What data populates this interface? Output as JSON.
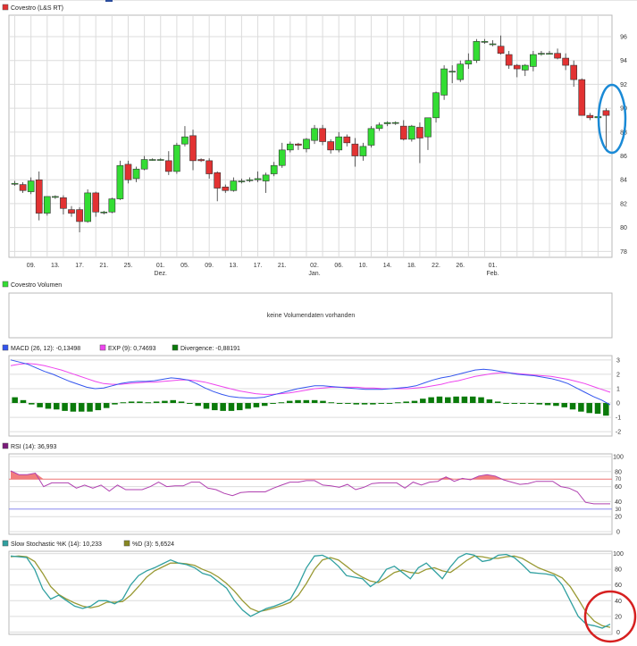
{
  "colors": {
    "candle_up": "#33dd33",
    "candle_down": "#e23232",
    "macd": "#3355ee",
    "exp": "#ee44ee",
    "divergence": "#0a7a0a",
    "rsi": "#b040b0",
    "rsi_upper": "#ee7777",
    "rsi_lower": "#8888ee",
    "stoch_k": "#30a0a0",
    "stoch_d": "#999933",
    "annotation_blue": "#1a8ad6",
    "annotation_red": "#d62020"
  },
  "chart_data": [
    {
      "type": "candlestick",
      "legend": "Covestro (L&S RT)",
      "yticks": [
        96,
        94,
        92,
        90,
        88,
        86,
        84,
        82,
        80,
        78
      ],
      "ylim": [
        77.5,
        97.8
      ],
      "xticks": [
        {
          "i": 2,
          "label": "09."
        },
        {
          "i": 5,
          "label": "13."
        },
        {
          "i": 8,
          "label": "17."
        },
        {
          "i": 11,
          "label": "21."
        },
        {
          "i": 14,
          "label": "25."
        },
        {
          "i": 18,
          "label": "01.",
          "sub": "Dez."
        },
        {
          "i": 21,
          "label": "05."
        },
        {
          "i": 24,
          "label": "09."
        },
        {
          "i": 27,
          "label": "13."
        },
        {
          "i": 30,
          "label": "17."
        },
        {
          "i": 33,
          "label": "21."
        },
        {
          "i": 37,
          "label": "02.",
          "sub": "Jan."
        },
        {
          "i": 40,
          "label": "06."
        },
        {
          "i": 43,
          "label": "10."
        },
        {
          "i": 46,
          "label": "14."
        },
        {
          "i": 49,
          "label": "18."
        },
        {
          "i": 52,
          "label": "22."
        },
        {
          "i": 55,
          "label": "26."
        },
        {
          "i": 59,
          "label": "01.",
          "sub": "Feb."
        }
      ],
      "candles": [
        {
          "o": 83.7,
          "h": 83.9,
          "l": 83.5,
          "c": 83.7
        },
        {
          "o": 83.6,
          "h": 83.8,
          "l": 82.9,
          "c": 83.1
        },
        {
          "o": 83.0,
          "h": 84.2,
          "l": 82.8,
          "c": 83.9
        },
        {
          "o": 84.0,
          "h": 84.7,
          "l": 80.6,
          "c": 81.2
        },
        {
          "o": 81.2,
          "h": 82.6,
          "l": 81.0,
          "c": 82.6
        },
        {
          "o": 82.6,
          "h": 82.7,
          "l": 82.4,
          "c": 82.6
        },
        {
          "o": 82.5,
          "h": 82.7,
          "l": 81.1,
          "c": 81.6
        },
        {
          "o": 81.5,
          "h": 81.8,
          "l": 80.9,
          "c": 81.2
        },
        {
          "o": 81.5,
          "h": 81.7,
          "l": 79.6,
          "c": 80.5
        },
        {
          "o": 80.5,
          "h": 83.2,
          "l": 80.4,
          "c": 82.9
        },
        {
          "o": 82.9,
          "h": 83.0,
          "l": 80.9,
          "c": 81.3
        },
        {
          "o": 81.3,
          "h": 81.4,
          "l": 81.1,
          "c": 81.3
        },
        {
          "o": 81.3,
          "h": 82.5,
          "l": 81.2,
          "c": 82.4
        },
        {
          "o": 82.4,
          "h": 85.6,
          "l": 82.3,
          "c": 85.2
        },
        {
          "o": 85.3,
          "h": 85.6,
          "l": 83.7,
          "c": 84.0
        },
        {
          "o": 84.1,
          "h": 85.1,
          "l": 83.8,
          "c": 84.9
        },
        {
          "o": 84.9,
          "h": 86.0,
          "l": 84.8,
          "c": 85.7
        },
        {
          "o": 85.7,
          "h": 85.8,
          "l": 85.6,
          "c": 85.7
        },
        {
          "o": 85.7,
          "h": 85.8,
          "l": 85.6,
          "c": 85.7
        },
        {
          "o": 85.6,
          "h": 86.4,
          "l": 84.4,
          "c": 84.7
        },
        {
          "o": 84.7,
          "h": 87.1,
          "l": 84.5,
          "c": 86.9
        },
        {
          "o": 87.0,
          "h": 88.5,
          "l": 86.8,
          "c": 87.6
        },
        {
          "o": 87.7,
          "h": 88.2,
          "l": 84.8,
          "c": 85.6
        },
        {
          "o": 85.7,
          "h": 85.8,
          "l": 85.5,
          "c": 85.6
        },
        {
          "o": 85.6,
          "h": 85.8,
          "l": 84.1,
          "c": 84.5
        },
        {
          "o": 84.6,
          "h": 84.7,
          "l": 82.2,
          "c": 83.3
        },
        {
          "o": 83.4,
          "h": 83.6,
          "l": 82.9,
          "c": 83.1
        },
        {
          "o": 83.1,
          "h": 84.2,
          "l": 83.0,
          "c": 83.9
        },
        {
          "o": 83.9,
          "h": 84.1,
          "l": 83.7,
          "c": 83.9
        },
        {
          "o": 84.0,
          "h": 84.2,
          "l": 83.8,
          "c": 84.0
        },
        {
          "o": 84.0,
          "h": 84.7,
          "l": 83.8,
          "c": 84.1
        },
        {
          "o": 83.9,
          "h": 84.6,
          "l": 82.9,
          "c": 84.4
        },
        {
          "o": 84.5,
          "h": 85.5,
          "l": 84.3,
          "c": 85.2
        },
        {
          "o": 85.2,
          "h": 87.1,
          "l": 85.0,
          "c": 86.5
        },
        {
          "o": 86.5,
          "h": 87.2,
          "l": 86.3,
          "c": 87.0
        },
        {
          "o": 87.0,
          "h": 87.1,
          "l": 86.5,
          "c": 86.9
        },
        {
          "o": 86.6,
          "h": 87.5,
          "l": 86.3,
          "c": 87.4
        },
        {
          "o": 87.3,
          "h": 88.6,
          "l": 87.0,
          "c": 88.3
        },
        {
          "o": 88.3,
          "h": 88.6,
          "l": 86.9,
          "c": 87.2
        },
        {
          "o": 87.2,
          "h": 87.4,
          "l": 86.2,
          "c": 86.5
        },
        {
          "o": 86.5,
          "h": 88.0,
          "l": 86.3,
          "c": 87.6
        },
        {
          "o": 87.6,
          "h": 87.8,
          "l": 86.8,
          "c": 87.1
        },
        {
          "o": 87.0,
          "h": 87.5,
          "l": 85.1,
          "c": 86.0
        },
        {
          "o": 86.0,
          "h": 87.1,
          "l": 85.6,
          "c": 86.8
        },
        {
          "o": 86.9,
          "h": 88.5,
          "l": 86.7,
          "c": 88.3
        },
        {
          "o": 88.3,
          "h": 88.8,
          "l": 88.1,
          "c": 88.6
        },
        {
          "o": 88.7,
          "h": 88.9,
          "l": 88.5,
          "c": 88.8
        },
        {
          "o": 88.8,
          "h": 88.9,
          "l": 88.6,
          "c": 88.8
        },
        {
          "o": 88.5,
          "h": 89.0,
          "l": 87.3,
          "c": 87.4
        },
        {
          "o": 87.4,
          "h": 88.6,
          "l": 87.2,
          "c": 88.5
        },
        {
          "o": 88.4,
          "h": 88.8,
          "l": 85.4,
          "c": 87.5
        },
        {
          "o": 87.6,
          "h": 89.2,
          "l": 86.5,
          "c": 89.2
        },
        {
          "o": 89.2,
          "h": 91.4,
          "l": 88.8,
          "c": 91.3
        },
        {
          "o": 91.1,
          "h": 93.6,
          "l": 90.7,
          "c": 93.3
        },
        {
          "o": 93.1,
          "h": 93.6,
          "l": 92.1,
          "c": 93.1
        },
        {
          "o": 92.4,
          "h": 94.0,
          "l": 92.2,
          "c": 93.7
        },
        {
          "o": 93.7,
          "h": 94.6,
          "l": 93.3,
          "c": 94.0
        },
        {
          "o": 94.0,
          "h": 95.8,
          "l": 93.8,
          "c": 95.6
        },
        {
          "o": 95.6,
          "h": 95.8,
          "l": 95.4,
          "c": 95.6
        },
        {
          "o": 95.4,
          "h": 95.7,
          "l": 95.2,
          "c": 95.4
        },
        {
          "o": 95.2,
          "h": 96.1,
          "l": 94.5,
          "c": 94.6
        },
        {
          "o": 94.5,
          "h": 94.8,
          "l": 93.3,
          "c": 93.6
        },
        {
          "o": 93.6,
          "h": 93.7,
          "l": 92.6,
          "c": 93.3
        },
        {
          "o": 93.2,
          "h": 93.7,
          "l": 92.7,
          "c": 93.6
        },
        {
          "o": 93.5,
          "h": 94.8,
          "l": 93.1,
          "c": 94.5
        },
        {
          "o": 94.6,
          "h": 94.8,
          "l": 94.4,
          "c": 94.6
        },
        {
          "o": 94.6,
          "h": 94.8,
          "l": 94.5,
          "c": 94.6
        },
        {
          "o": 94.6,
          "h": 95.0,
          "l": 94.1,
          "c": 94.2
        },
        {
          "o": 94.2,
          "h": 94.6,
          "l": 93.2,
          "c": 93.6
        },
        {
          "o": 93.6,
          "h": 94.0,
          "l": 91.8,
          "c": 92.4
        },
        {
          "o": 92.4,
          "h": 92.5,
          "l": 89.4,
          "c": 89.4
        },
        {
          "o": 89.4,
          "h": 89.6,
          "l": 89.0,
          "c": 89.2
        },
        {
          "o": 89.2,
          "h": 89.5,
          "l": 88.6,
          "c": 89.3
        },
        {
          "o": 89.8,
          "h": 90.0,
          "l": 86.4,
          "c": 89.4
        }
      ]
    },
    {
      "type": "table",
      "legend": "Covestro Volumen",
      "message": "keine Volumendaten vorhanden"
    },
    {
      "type": "line",
      "legend": [
        {
          "text": "MACD (26, 12): -0,13498",
          "color": "#3355ee"
        },
        {
          "text": "EXP (9): 0,74693",
          "color": "#ee44ee"
        },
        {
          "text": "Divergence: -0,88191",
          "color": "#0a7a0a"
        }
      ],
      "yticks": [
        3,
        2,
        1,
        0,
        -1,
        -2
      ],
      "ylim": [
        -2.3,
        3.3
      ],
      "macd": [
        3.0,
        2.85,
        2.7,
        2.45,
        2.2,
        2.0,
        1.75,
        1.5,
        1.3,
        1.1,
        1.0,
        1.05,
        1.2,
        1.35,
        1.45,
        1.5,
        1.5,
        1.55,
        1.65,
        1.75,
        1.7,
        1.6,
        1.35,
        1.05,
        0.8,
        0.6,
        0.45,
        0.38,
        0.35,
        0.35,
        0.4,
        0.55,
        0.7,
        0.85,
        1.0,
        1.1,
        1.2,
        1.2,
        1.15,
        1.1,
        1.05,
        1.0,
        0.95,
        0.95,
        0.95,
        1.0,
        1.05,
        1.1,
        1.2,
        1.4,
        1.6,
        1.75,
        1.85,
        2.0,
        2.15,
        2.3,
        2.35,
        2.3,
        2.2,
        2.1,
        2.0,
        1.95,
        1.9,
        1.8,
        1.7,
        1.55,
        1.35,
        1.05,
        0.75,
        0.45,
        0.2,
        -0.13
      ],
      "exp": [
        2.6,
        2.7,
        2.75,
        2.7,
        2.6,
        2.45,
        2.3,
        2.1,
        1.9,
        1.7,
        1.5,
        1.35,
        1.3,
        1.3,
        1.35,
        1.4,
        1.45,
        1.45,
        1.5,
        1.55,
        1.6,
        1.6,
        1.55,
        1.45,
        1.3,
        1.15,
        1.0,
        0.85,
        0.75,
        0.65,
        0.6,
        0.6,
        0.65,
        0.7,
        0.8,
        0.9,
        1.0,
        1.05,
        1.1,
        1.1,
        1.1,
        1.1,
        1.05,
        1.05,
        1.0,
        1.0,
        1.0,
        1.0,
        1.05,
        1.1,
        1.2,
        1.3,
        1.45,
        1.55,
        1.7,
        1.85,
        1.95,
        2.05,
        2.1,
        2.1,
        2.05,
        2.0,
        1.95,
        1.9,
        1.85,
        1.75,
        1.65,
        1.5,
        1.35,
        1.15,
        0.95,
        0.75
      ],
      "divergence": [
        0.4,
        0.2,
        -0.1,
        -0.3,
        -0.4,
        -0.45,
        -0.55,
        -0.6,
        -0.6,
        -0.6,
        -0.5,
        -0.35,
        -0.1,
        0.05,
        0.1,
        0.1,
        0.05,
        0.1,
        0.15,
        0.2,
        0.1,
        0.0,
        -0.2,
        -0.4,
        -0.5,
        -0.55,
        -0.55,
        -0.5,
        -0.4,
        -0.3,
        -0.2,
        -0.05,
        0.05,
        0.15,
        0.2,
        0.2,
        0.2,
        0.15,
        0.05,
        0.0,
        -0.05,
        -0.1,
        -0.1,
        -0.1,
        -0.05,
        0.0,
        0.05,
        0.1,
        0.15,
        0.3,
        0.4,
        0.45,
        0.4,
        0.45,
        0.45,
        0.45,
        0.4,
        0.25,
        0.1,
        0.0,
        -0.05,
        -0.05,
        -0.05,
        -0.1,
        -0.15,
        -0.2,
        -0.3,
        -0.45,
        -0.6,
        -0.7,
        -0.75,
        -0.88
      ]
    },
    {
      "type": "line",
      "legend": [
        {
          "text": "RSI (14): 36,993",
          "color": "#b040b0"
        }
      ],
      "yticks": [
        100,
        80,
        60,
        40,
        20,
        0
      ],
      "ylim": [
        0,
        100
      ],
      "upper": 70,
      "lower": 30,
      "rsi": [
        81,
        76,
        76,
        78,
        60,
        65,
        65,
        65,
        58,
        62,
        58,
        62,
        54,
        62,
        56,
        56,
        56,
        60,
        66,
        60,
        61,
        61,
        66,
        66,
        58,
        56,
        51,
        48,
        52,
        53,
        53,
        53,
        58,
        62,
        66,
        66,
        68,
        68,
        62,
        61,
        59,
        63,
        56,
        59,
        64,
        65,
        65,
        65,
        58,
        66,
        62,
        66,
        67,
        73,
        67,
        71,
        69,
        74,
        76,
        74,
        69,
        66,
        63,
        64,
        67,
        67,
        67,
        60,
        58,
        53,
        39,
        37,
        37,
        37
      ],
      "rsi_label_upper": "70",
      "rsi_label_lower": "30"
    },
    {
      "type": "line",
      "legend": [
        {
          "text": "Slow Stochastic %K (14): 10,233",
          "color": "#30a0a0"
        },
        {
          "text": "%D (3): 5,6524",
          "color": "#888822"
        }
      ],
      "yticks": [
        100,
        80,
        60,
        40,
        20,
        0
      ],
      "ylim": [
        -3,
        103
      ],
      "k": [
        97,
        96,
        95,
        80,
        55,
        42,
        47,
        40,
        33,
        30,
        33,
        40,
        40,
        36,
        42,
        60,
        72,
        78,
        82,
        87,
        92,
        88,
        86,
        82,
        75,
        72,
        64,
        56,
        40,
        28,
        20,
        25,
        30,
        33,
        37,
        42,
        60,
        82,
        97,
        98,
        93,
        84,
        72,
        70,
        68,
        58,
        65,
        80,
        84,
        76,
        68,
        82,
        88,
        78,
        68,
        83,
        95,
        100,
        98,
        90,
        92,
        98,
        99,
        95,
        86,
        76,
        75,
        74,
        72,
        60,
        40,
        20,
        10,
        8,
        5,
        10
      ],
      "d": [
        96,
        97,
        96,
        90,
        75,
        58,
        48,
        42,
        37,
        33,
        31,
        33,
        38,
        38,
        39,
        47,
        58,
        70,
        78,
        83,
        88,
        88,
        87,
        85,
        80,
        76,
        70,
        62,
        52,
        40,
        30,
        26,
        28,
        31,
        34,
        38,
        47,
        62,
        80,
        92,
        95,
        92,
        84,
        76,
        70,
        65,
        63,
        69,
        76,
        79,
        76,
        75,
        80,
        82,
        78,
        76,
        83,
        91,
        97,
        96,
        94,
        94,
        96,
        97,
        94,
        88,
        82,
        78,
        74,
        69,
        58,
        42,
        25,
        14,
        8,
        6
      ]
    }
  ]
}
